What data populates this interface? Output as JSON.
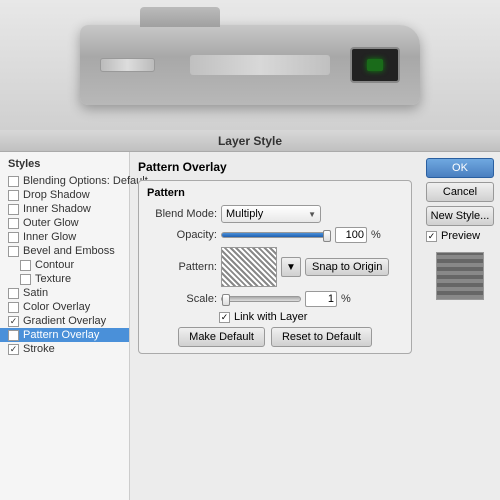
{
  "camera": {
    "alt": "Camera preview image"
  },
  "dialog": {
    "title": "Layer Style"
  },
  "sidebar": {
    "header": "Styles",
    "items": [
      {
        "id": "blending-options",
        "label": "Blending Options: Default",
        "checked": false,
        "indented": false,
        "active": false
      },
      {
        "id": "drop-shadow",
        "label": "Drop Shadow",
        "checked": false,
        "indented": false,
        "active": false
      },
      {
        "id": "inner-shadow",
        "label": "Inner Shadow",
        "checked": false,
        "indented": false,
        "active": false
      },
      {
        "id": "outer-glow",
        "label": "Outer Glow",
        "checked": false,
        "indented": false,
        "active": false
      },
      {
        "id": "inner-glow",
        "label": "Inner Glow",
        "checked": false,
        "indented": false,
        "active": false
      },
      {
        "id": "bevel-emboss",
        "label": "Bevel and Emboss",
        "checked": false,
        "indented": false,
        "active": false
      },
      {
        "id": "contour",
        "label": "Contour",
        "checked": false,
        "indented": true,
        "active": false
      },
      {
        "id": "texture",
        "label": "Texture",
        "checked": false,
        "indented": true,
        "active": false
      },
      {
        "id": "satin",
        "label": "Satin",
        "checked": false,
        "indented": false,
        "active": false
      },
      {
        "id": "color-overlay",
        "label": "Color Overlay",
        "checked": false,
        "indented": false,
        "active": false
      },
      {
        "id": "gradient-overlay",
        "label": "Gradient Overlay",
        "checked": true,
        "indented": false,
        "active": false
      },
      {
        "id": "pattern-overlay",
        "label": "Pattern Overlay",
        "checked": true,
        "indented": false,
        "active": true
      },
      {
        "id": "stroke",
        "label": "Stroke",
        "checked": true,
        "indented": false,
        "active": false
      }
    ]
  },
  "main": {
    "section_title": "Pattern Overlay",
    "subsection_title": "Pattern",
    "blend_mode": {
      "label": "Blend Mode:",
      "value": "Multiply"
    },
    "opacity": {
      "label": "Opacity:",
      "value": "100",
      "percent": "%",
      "slider_pct": 100
    },
    "pattern": {
      "label": "Pattern:",
      "snap_btn": "Snap to Origin"
    },
    "scale": {
      "label": "Scale:",
      "value": "1",
      "percent": "%",
      "slider_pct": 0
    },
    "link_layer": {
      "label": "Link with Layer",
      "checked": true
    },
    "make_default_btn": "Make Default",
    "reset_btn": "Reset to Default"
  },
  "right_panel": {
    "ok_btn": "OK",
    "cancel_btn": "Cancel",
    "new_style_btn": "New Style...",
    "preview_label": "Preview",
    "preview_checked": true
  }
}
